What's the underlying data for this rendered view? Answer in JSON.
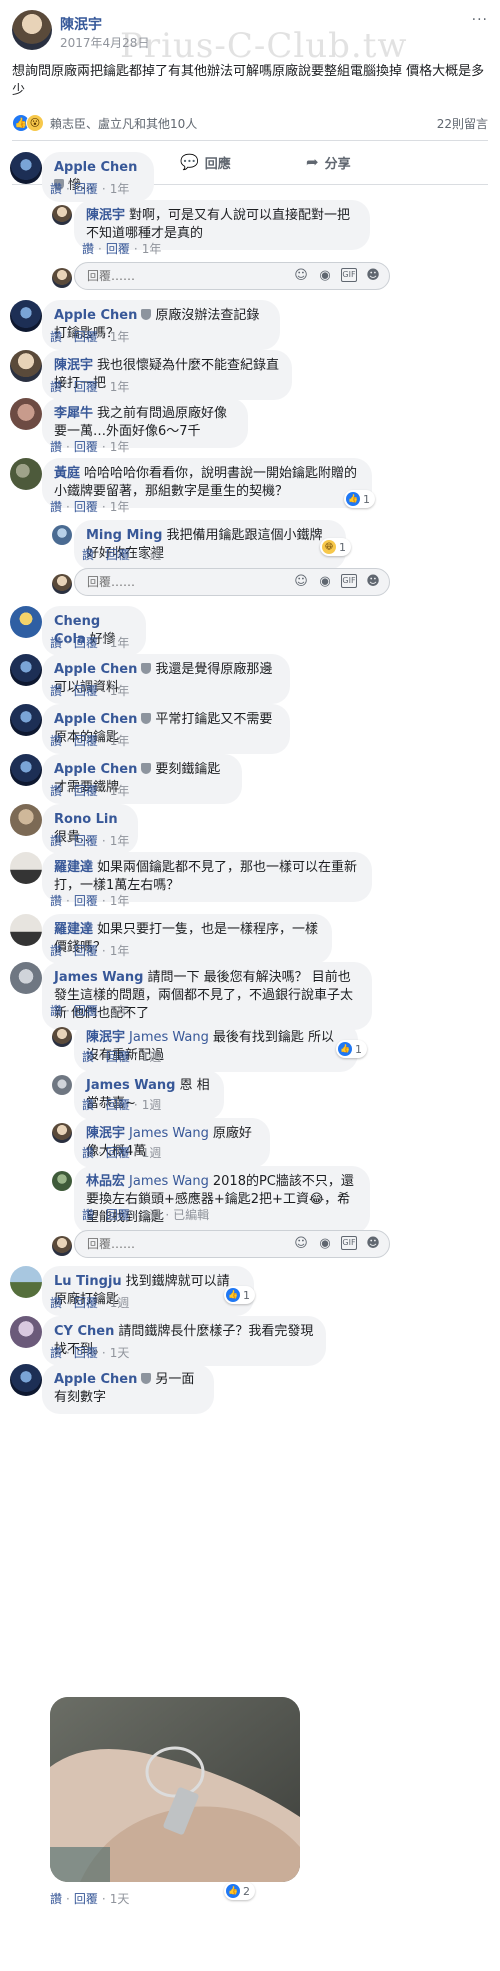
{
  "post": {
    "author": "陳泯宇",
    "date": "2017年4月28日",
    "menu": "···",
    "watermark": "Prius-C-Club.tw",
    "text": "想詢問原廠兩把鑰匙都掉了有其他辦法可解嗎原廠說要整組電腦換掉 價格大概是多少",
    "reactions_label": "賴志臣、盧立凡和其他10人",
    "comment_count": "22則留言",
    "actions": {
      "like": "讚",
      "comment": "回應",
      "share": "分享"
    }
  },
  "meta_labels": {
    "like": "讚",
    "reply": "回覆",
    "edited": "已編輯"
  },
  "reply_placeholder": "回覆……",
  "comments": [
    {
      "id": "c1",
      "name": "Apple Chen",
      "shield": true,
      "text": "慘…",
      "time": "1年"
    },
    {
      "id": "r1",
      "name": "陳泯宇",
      "text": "對啊，可是又有人說可以直接配對一把 不知道哪種才是真的",
      "time": "1年"
    },
    {
      "id": "c2",
      "name": "Apple Chen",
      "shield": true,
      "text": "原廠沒辦法查記錄打鑰匙嗎？",
      "time": "1年"
    },
    {
      "id": "c3",
      "name": "陳泯宇",
      "text": "我也很懷疑為什麼不能查紀錄直接打一把",
      "time": "1年"
    },
    {
      "id": "c4",
      "name": "李犀牛",
      "text": "我之前有問過原廠好像要一萬…外面好像6～7千",
      "time": "1年"
    },
    {
      "id": "c5",
      "name": "黃庭",
      "text": "哈哈哈哈你看看你，說明書說一開始鑰匙附贈的小鐵牌要留著，那組數字是重生的契機？",
      "time": "1年",
      "reactions": "1"
    },
    {
      "id": "r2",
      "name": "Ming Ming",
      "text": "我把備用鑰匙跟這個小鐵牌好好收在家裡",
      "time": "1週",
      "reactions": "1"
    },
    {
      "id": "c6",
      "name": "Cheng Cola",
      "text": "好慘",
      "time": "1年"
    },
    {
      "id": "c7",
      "name": "Apple Chen",
      "shield": true,
      "text": "我還是覺得原廠那邊可以調資料",
      "time": "1年"
    },
    {
      "id": "c8",
      "name": "Apple Chen",
      "shield": true,
      "text": "平常打鑰匙又不需要原本的鑰匙",
      "time": "1年"
    },
    {
      "id": "c9",
      "name": "Apple Chen",
      "shield": true,
      "text": "要刻鐵鑰匙才需要鐵牌",
      "time": "1年"
    },
    {
      "id": "c10",
      "name": "Rono Lin",
      "text": "很貴…",
      "time": "1年"
    },
    {
      "id": "c11",
      "name": "羅建達",
      "text": "如果兩個鑰匙都不見了，那也一樣可以在重新打，一樣1萬左右嗎？",
      "time": "1年"
    },
    {
      "id": "c12",
      "name": "羅建達",
      "text": "如果只要打一隻，也是一樣程序，一樣價錢嗎？",
      "time": "1年"
    },
    {
      "id": "c13",
      "name": "James Wang",
      "text": "請問一下 最後您有解決嗎？ 目前也發生這樣的問題，兩個都不見了，不過銀行說車子太新 他們也配不了",
      "time": "1年"
    },
    {
      "id": "r3",
      "name": "陳泯宇",
      "mention": "James Wang",
      "text": "最後有找到鑰匙 所以沒有重新配過",
      "time": "1週",
      "reactions": "1"
    },
    {
      "id": "r4",
      "name": "James Wang",
      "text": "恩 相當恭喜~",
      "time": "1週"
    },
    {
      "id": "r5",
      "name": "陳泯宇",
      "mention": "James Wang",
      "text": "原廠好像大概4萬",
      "time": "1週"
    },
    {
      "id": "r6",
      "name": "林品宏",
      "mention": "James Wang",
      "text": "2018的PC牆該不只，還要換左右鎖頭+感應器+鑰匙2把+工資😂，希望能找到鑰匙",
      "time": "1週",
      "edited": true
    },
    {
      "id": "c14",
      "name": "Lu Tingju",
      "text": "找到鐵牌就可以請原廠打鑰匙",
      "time": "1週",
      "reactions": "1"
    },
    {
      "id": "c15",
      "name": "CY Chen",
      "text": "請問鐵牌長什麼樣子？我看完發現找不到。",
      "time": "1天"
    },
    {
      "id": "c16",
      "name": "Apple Chen",
      "shield": true,
      "text": "另一面有刻數字",
      "time": "1天",
      "reactions": "2"
    }
  ],
  "colors": {
    "link": "#385898",
    "bubble": "#f2f3f5",
    "like_blue": "#2078f4",
    "meta": "#90949c"
  },
  "icons": {
    "like": "thumbs-up-icon",
    "comment": "speech-bubble-icon",
    "share": "share-arrow-icon",
    "emoji": "emoji-icon",
    "camera": "camera-icon",
    "gif": "gif-icon",
    "sticker": "sticker-icon"
  }
}
